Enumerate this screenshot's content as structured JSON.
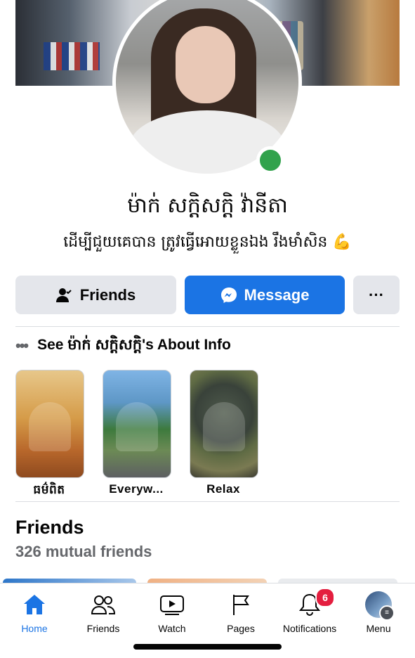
{
  "profile": {
    "name": "ម៉ាក់ សក្ដិសក្ដិ វ៉ានីតា",
    "bio": "ដើម្បីជួយគេបាន ត្រូវធ្វើអោយខ្លួនឯង រឹងមាំសិន 💪",
    "online": true
  },
  "actions": {
    "friends_label": "Friends",
    "message_label": "Message",
    "more_label": "···"
  },
  "about": {
    "dots": "•••",
    "text": "See ម៉ាក់ សក្ដិសក្ដិ's About Info"
  },
  "highlights": [
    {
      "label": "ធម៌ពិត"
    },
    {
      "label": "Everyw..."
    },
    {
      "label": "Relax"
    }
  ],
  "friends_section": {
    "title": "Friends",
    "count": "326 mutual friends"
  },
  "tabbar": {
    "tabs": [
      {
        "label": "Home",
        "icon": "home-icon",
        "active": true
      },
      {
        "label": "Friends",
        "icon": "friends-icon"
      },
      {
        "label": "Watch",
        "icon": "watch-icon"
      },
      {
        "label": "Pages",
        "icon": "pages-flag-icon"
      },
      {
        "label": "Notifications",
        "icon": "bell-icon",
        "badge": "6"
      },
      {
        "label": "Menu",
        "icon": "menu-avatar-icon"
      }
    ]
  },
  "colors": {
    "accent": "#1b74e4",
    "online": "#31a24c",
    "badge": "#e41e3f"
  }
}
